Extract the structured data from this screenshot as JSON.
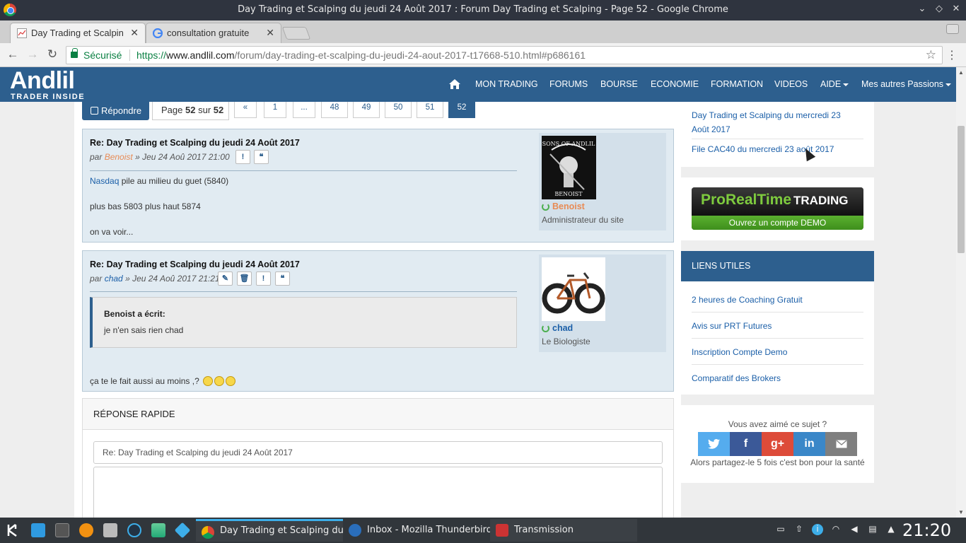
{
  "window": {
    "title": "Day Trading et Scalping du jeudi 24 Août 2017 : Forum Day Trading et Scalping - Page 52 - Google Chrome"
  },
  "tabs": [
    {
      "label": "Day Trading et Scalpin"
    },
    {
      "label": "consultation gratuite"
    }
  ],
  "address": {
    "secure_label": "Sécurisé",
    "scheme": "https://",
    "host": "www.andlil.com",
    "path": "/forum/day-trading-et-scalping-du-jeudi-24-aout-2017-t17668-510.html#p686161"
  },
  "site": {
    "logo": "Andlil",
    "logo_tagline": "TRADER INSIDE",
    "nav": [
      "MON TRADING",
      "FORUMS",
      "BOURSE",
      "ECONOMIE",
      "FORMATION",
      "VIDEOS",
      "AIDE",
      "Mes autres Passions"
    ]
  },
  "pagination": {
    "reply_label": "Répondre",
    "page_prefix": "Page",
    "page_current": "52",
    "page_sep": "sur",
    "page_total": "52",
    "links": [
      "«",
      "1",
      "...",
      "48",
      "49",
      "50",
      "51",
      "52"
    ]
  },
  "posts": [
    {
      "title": "Re: Day Trading et Scalping du jeudi 24 Août 2017",
      "by": "par",
      "author": "Benoist",
      "date": "» Jeu 24 Aoû 2017 21:00",
      "line1_link": "Nasdaq",
      "line1_rest": " pile au milieu du guet (5840)",
      "line2": "plus bas 5803 plus haut 5874",
      "line3": "on va voir...",
      "rank": "Administrateur du site",
      "avatar_text_top": "SONS OF ANDLIL",
      "avatar_text_bottom": "BENOIST"
    },
    {
      "title": "Re: Day Trading et Scalping du jeudi 24 Août 2017",
      "by": "par",
      "author": "chad",
      "date": "» Jeu 24 Aoû 2017 21:21",
      "quote_head": "Benoist a écrit:",
      "quote_body": "je n'en sais rien chad",
      "line1": "ça te le fait aussi au moins ,?",
      "rank": "Le Biologiste"
    }
  ],
  "quick_reply": {
    "heading": "RÉPONSE RAPIDE",
    "subject": "Re: Day Trading et Scalping du jeudi 24 Août 2017"
  },
  "sidebar": {
    "recent": [
      "Day Trading et Scalping du mercredi 23 Août 2017",
      "File CAC40 du mercredi 23 août 2017"
    ],
    "banner_brand": "ProRealTime",
    "banner_trading": "TRADING",
    "banner_cta": "Ouvrez un compte DEMO",
    "liens_title": "LIENS UTILES",
    "liens": [
      "2 heures de Coaching Gratuit",
      "Avis sur PRT Futures",
      "Inscription Compte Demo",
      "Comparatif des Brokers"
    ],
    "share_title": "Vous avez aimé ce sujet ?",
    "share_note": "Alors partagez-le 5 fois c'est bon pour la santé",
    "share_colors": {
      "twitter": "#55acee",
      "facebook": "#3b5998",
      "google": "#dd4b39",
      "linkedin": "#0e76a8",
      "email": "#7f7f7f"
    }
  },
  "taskbar": {
    "tasks": [
      "Day Trading et Scalping du...",
      "Inbox - Mozilla Thunderbird",
      "Transmission"
    ],
    "clock": "21:20"
  },
  "colors": {
    "brand": "#2d5f8e",
    "post_bg": "#e1ebf2"
  }
}
